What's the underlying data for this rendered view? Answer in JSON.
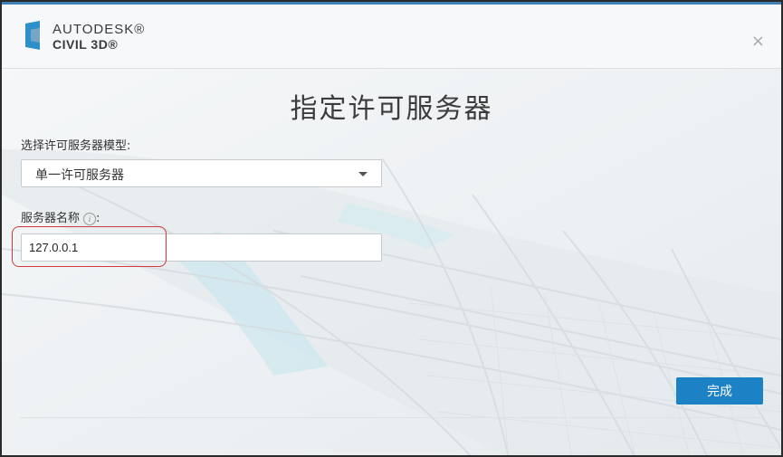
{
  "header": {
    "brand_top": "AUTODESK®",
    "brand_bottom": "CIVIL 3D®",
    "close_glyph": "×"
  },
  "title": "指定许可服务器",
  "server_model": {
    "label": "选择许可服务器模型:",
    "selected": "单一许可服务器"
  },
  "server_name": {
    "label": "服务器名称",
    "label_suffix": ":",
    "info_glyph": "i",
    "value": "127.0.0.1"
  },
  "footer": {
    "done_label": "完成"
  },
  "colors": {
    "accent": "#1c82c5",
    "highlight": "#d13a3a",
    "logo": "#2f8fc9"
  }
}
